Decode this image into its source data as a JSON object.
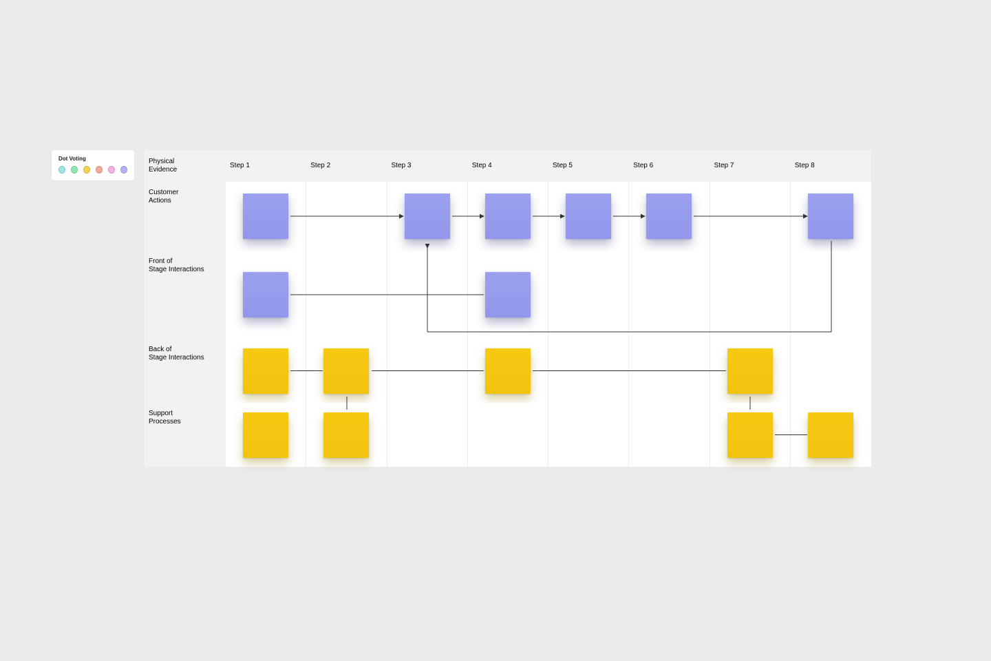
{
  "dot_voting": {
    "label": "Dot Voting",
    "colors": [
      "#9fe5e6",
      "#8de6b0",
      "#f4d352",
      "#f5a9a0",
      "#f3b2e4",
      "#b4b2f4"
    ]
  },
  "rows": {
    "header": [
      "Physical",
      "Evidence"
    ],
    "row1": [
      "Customer",
      "Actions"
    ],
    "row2": [
      "Front of",
      "Stage Interactions"
    ],
    "row3": [
      "Back of",
      "Stage Interactions"
    ],
    "row4": [
      "Support",
      "Processes"
    ]
  },
  "steps": [
    "Step 1",
    "Step 2",
    "Step 3",
    "Step 4",
    "Step 5",
    "Step 6",
    "Step 7",
    "Step 8"
  ],
  "stickies": {
    "row1": [
      {
        "step": 1,
        "color": "purple"
      },
      {
        "step": 3,
        "color": "purple"
      },
      {
        "step": 4,
        "color": "purple"
      },
      {
        "step": 5,
        "color": "purple"
      },
      {
        "step": 6,
        "color": "purple"
      },
      {
        "step": 8,
        "color": "purple"
      }
    ],
    "row2": [
      {
        "step": 1,
        "color": "purple"
      },
      {
        "step": 4,
        "color": "purple"
      }
    ],
    "row3": [
      {
        "step": 1,
        "color": "yellow"
      },
      {
        "step": 2,
        "color": "yellow"
      },
      {
        "step": 4,
        "color": "yellow"
      },
      {
        "step": 7,
        "color": "yellow"
      }
    ],
    "row4": [
      {
        "step": 1,
        "color": "yellow"
      },
      {
        "step": 2,
        "color": "yellow"
      },
      {
        "step": 7,
        "color": "yellow"
      },
      {
        "step": 8,
        "color": "yellow"
      }
    ]
  }
}
